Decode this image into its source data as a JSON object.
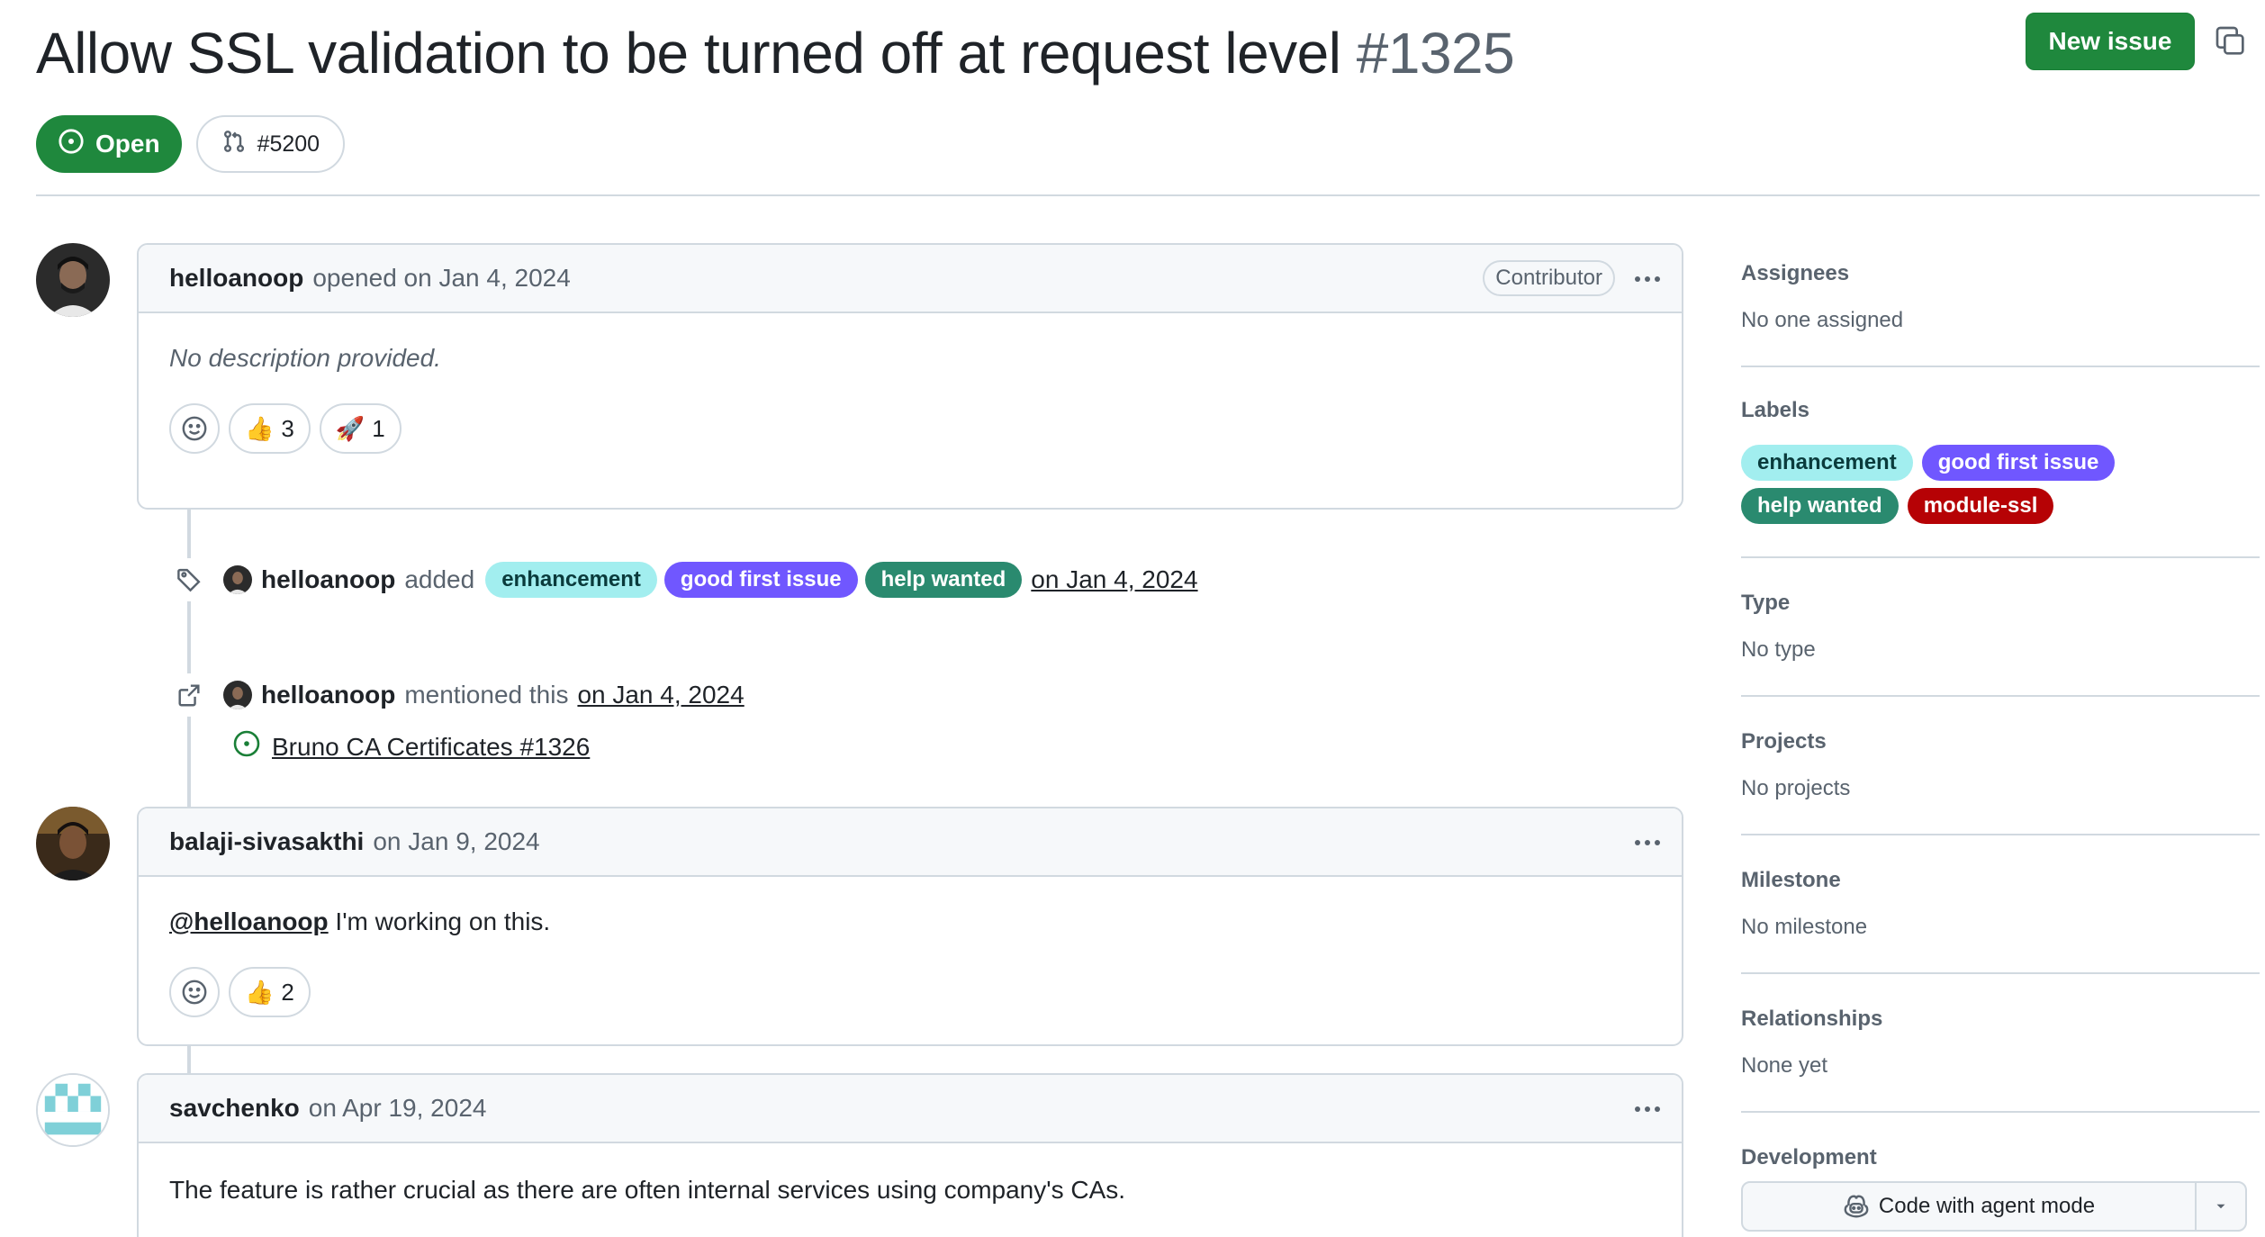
{
  "issue": {
    "title": "Allow SSL validation to be turned off at request level",
    "number": "#1325",
    "state": "Open",
    "linked_pr": "#5200",
    "new_issue_label": "New issue"
  },
  "comments": [
    {
      "author": "helloanoop",
      "meta": "opened on Jan 4, 2024",
      "badge": "Contributor",
      "body": "No description provided.",
      "reactions": [
        {
          "emoji": "👍",
          "count": "3"
        },
        {
          "emoji": "🚀",
          "count": "1"
        }
      ]
    },
    {
      "author": "balaji-sivasakthi",
      "meta": "on Jan 9, 2024",
      "mention": "@helloanoop",
      "body": "I'm working on this.",
      "reactions": [
        {
          "emoji": "👍",
          "count": "2"
        }
      ]
    },
    {
      "author": "savchenko",
      "meta": "on Apr 19, 2024",
      "body": "The feature is rather crucial as there are often internal services using company's CAs."
    }
  ],
  "events": [
    {
      "author": "helloanoop",
      "action": "added",
      "labels": [
        "enhancement",
        "good first issue",
        "help wanted"
      ],
      "date": "on Jan 4, 2024"
    },
    {
      "author": "helloanoop",
      "action": "mentioned this",
      "date": "on Jan 4, 2024",
      "reference": "Bruno CA Certificates #1326"
    }
  ],
  "sidebar": {
    "assignees": {
      "title": "Assignees",
      "value": "No one assigned"
    },
    "labels": {
      "title": "Labels",
      "items": [
        "enhancement",
        "good first issue",
        "help wanted",
        "module-ssl"
      ]
    },
    "type": {
      "title": "Type",
      "value": "No type"
    },
    "projects": {
      "title": "Projects",
      "value": "No projects"
    },
    "milestone": {
      "title": "Milestone",
      "value": "No milestone"
    },
    "relationships": {
      "title": "Relationships",
      "value": "None yet"
    },
    "development": {
      "title": "Development",
      "button": "Code with agent mode"
    }
  },
  "colors": {
    "open_green": "#1f883d",
    "label_enhancement": "#a2eeef",
    "label_good_first_issue": "#7057ff",
    "label_help_wanted": "#2a8a6f",
    "label_module_ssl": "#b60205"
  }
}
